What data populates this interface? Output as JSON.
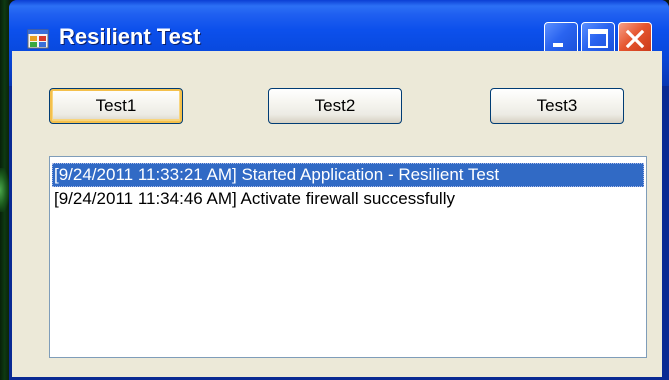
{
  "window": {
    "title": "Resilient Test",
    "icon": "app-window-icon",
    "caption_buttons": [
      "minimize-icon",
      "maximize-icon",
      "close-icon"
    ]
  },
  "buttons": {
    "test1": "Test1",
    "test2": "Test2",
    "test3": "Test3"
  },
  "log": {
    "items": [
      {
        "text": "[9/24/2011 11:33:21 AM] Started Application - Resilient Test",
        "selected": true
      },
      {
        "text": "[9/24/2011 11:34:46 AM] Activate firewall successfully",
        "selected": false
      }
    ]
  },
  "colors": {
    "titlebar": "#0c50ec",
    "window_face": "#ece9d8",
    "selection": "#316ac5",
    "close_button": "#e5552e"
  }
}
